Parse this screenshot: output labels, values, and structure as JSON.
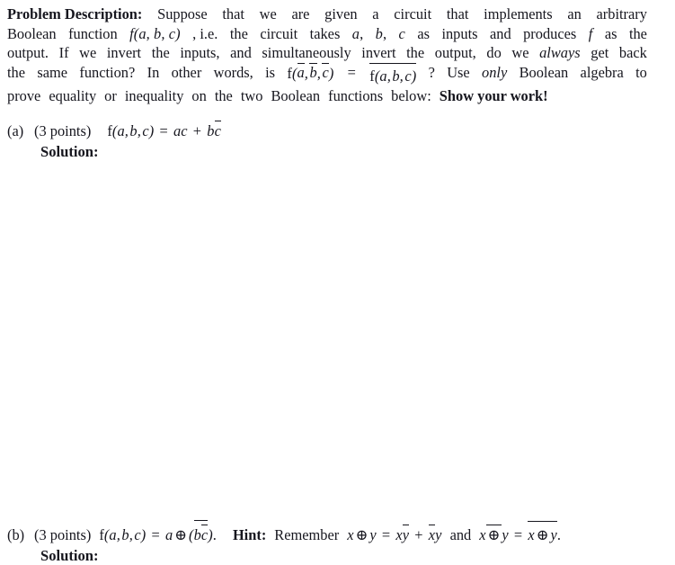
{
  "document": {
    "kind": "homework-problem-sheet",
    "background_color": "#ffffff",
    "text_color": "#16161e"
  },
  "problem": {
    "heading": "Problem Description:",
    "line1": {
      "w1": "Suppose",
      "w2": "that",
      "w3": "we",
      "w4": "are",
      "w5": "given",
      "w6": "a",
      "w7": "circuit",
      "w8": "that",
      "w9": "implements",
      "w10": "an",
      "w11": "arbitrary"
    },
    "line2": {
      "w1": "Boolean",
      "w2": "function",
      "math": "f(a, b, c)",
      "w3": ", i.e.",
      "w4": "the",
      "w5": "circuit",
      "w6": "takes",
      "m_a": "a",
      "m_b": "b",
      "m_c": "c",
      "w7": "as",
      "w8": "inputs",
      "w9": "and",
      "w10": "produces",
      "m_f": "f",
      "w11": "as",
      "w12": "the"
    },
    "line3": {
      "w1": "output.",
      "w2": "If",
      "w3": "we",
      "w4": "invert",
      "w5": "the",
      "w6": "inputs,",
      "w7": "and",
      "w8": "simultaneously",
      "w9": "invert",
      "w10": "the",
      "w11": "output,",
      "w12": "do",
      "w13": "we",
      "w14_italic": "always",
      "w15": "get",
      "w16": "back"
    },
    "line4": {
      "w1": "the",
      "w2": "same",
      "w3": "function?",
      "w4": "In",
      "w5": "other",
      "w6": "words,",
      "w7": "is",
      "lhs": "f(a, b, c)",
      "eq": "=",
      "rhs": "f(a, b, c)",
      "w8": "?",
      "w9": "Use",
      "w10_italic": "only",
      "w11": "Boolean",
      "w12": "algebra",
      "w13": "to"
    },
    "line5": {
      "w1": "prove",
      "w2": "equality",
      "w3": "or",
      "w4": "inequality",
      "w5": "on",
      "w6": "the",
      "w7": "two",
      "w8": "Boolean",
      "w9": "functions",
      "w10": "below:",
      "w11_bold": "Show your work!"
    }
  },
  "parts": [
    {
      "tag": "(a)",
      "points": "(3 points)",
      "expression_plain": "f(a, b, c) = ac + b c̄",
      "expr": {
        "fn": "f(a, b, c)",
        "equals": "=",
        "term1": "ac",
        "plus": "+",
        "term2_base": "b",
        "term2_bar": "c"
      },
      "solution_label": "Solution:",
      "hint": ""
    },
    {
      "tag": "(b)",
      "points": "(3 points)",
      "expression_plain": "f(a, b, c) = a ⊕ (b c̄ with bar)",
      "expr": {
        "fn": "f(a, b, c)",
        "equals": "=",
        "a": "a",
        "xor": "⊕",
        "open": "(",
        "inner_b": "b",
        "inner_c": "c",
        "close": ")",
        "period": "."
      },
      "hint_label": "Hint:",
      "hint_text": "Remember",
      "hint_expr": {
        "x1": "x",
        "xor1": "⊕",
        "y1": "y",
        "eq1": "=",
        "t1a": "x",
        "t1b": "y",
        "plus": "+",
        "t2a": "x",
        "t2b": "y",
        "and_word": "and",
        "x2": "x",
        "xor2": "⊕",
        "y2": "y",
        "eq2": "=",
        "r1": "x",
        "xor3": "⊕",
        "r2": "y",
        "period": "."
      },
      "solution_label": "Solution:"
    }
  ]
}
